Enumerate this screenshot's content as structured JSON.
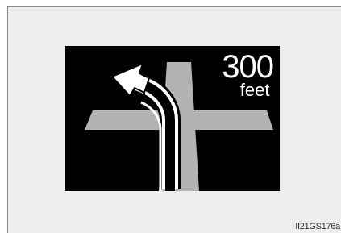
{
  "display": {
    "distance_value": "300",
    "distance_unit": "feet",
    "turn_icon": "left-turn-arrow-icon",
    "colors": {
      "background": "#000000",
      "road": "#b3b3b3",
      "text": "#ffffff"
    }
  },
  "caption": "II21GS176a"
}
